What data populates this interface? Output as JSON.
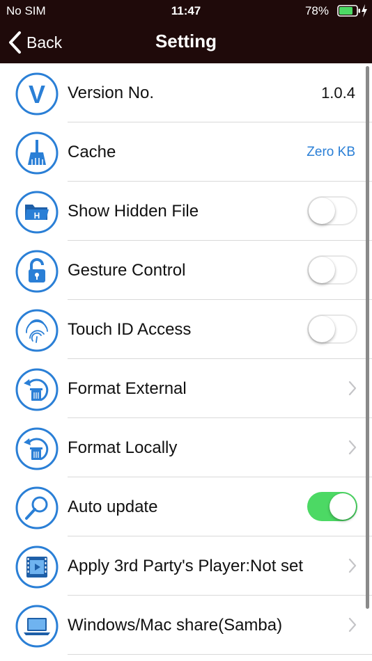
{
  "status": {
    "carrier": "No SIM",
    "time": "11:47",
    "battery_pct": "78%"
  },
  "nav": {
    "back_label": "Back",
    "title": "Setting"
  },
  "colors": {
    "accent": "#2a7fd6",
    "toggle_on": "#4cd964",
    "header_bg": "#1f0a0a"
  },
  "rows": [
    {
      "label": "Version No.",
      "value": "1.0.4",
      "icon": "version-icon"
    },
    {
      "label": "Cache",
      "value": "Zero KB",
      "icon": "broom-icon"
    },
    {
      "label": "Show Hidden File",
      "toggle": false,
      "icon": "hidden-folder-icon"
    },
    {
      "label": "Gesture Control",
      "toggle": false,
      "icon": "lock-icon"
    },
    {
      "label": "Touch ID Access",
      "toggle": false,
      "icon": "fingerprint-icon"
    },
    {
      "label": "Format External",
      "icon": "format-trash-icon"
    },
    {
      "label": "Format Locally",
      "icon": "format-trash-icon"
    },
    {
      "label": "Auto update",
      "toggle": true,
      "icon": "magnifier-icon"
    },
    {
      "label": "Apply 3rd Party's Player:Not set",
      "icon": "film-player-icon"
    },
    {
      "label": "Windows/Mac share(Samba)",
      "icon": "laptop-icon"
    }
  ]
}
